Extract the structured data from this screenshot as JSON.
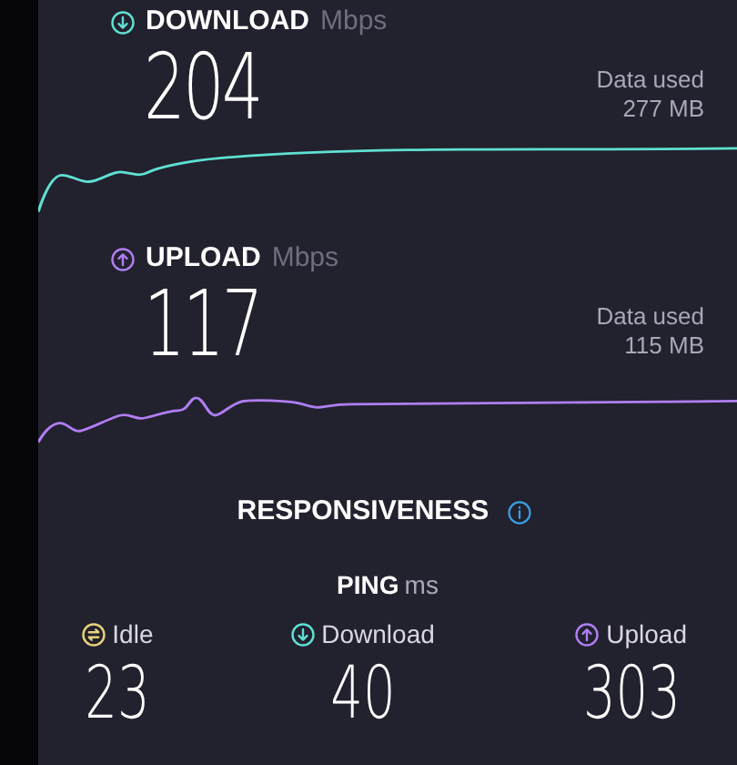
{
  "speeds": [
    {
      "kind": "download",
      "label": "DOWNLOAD",
      "unit": "Mbps",
      "value": "204",
      "data_label": "Data used",
      "data_value": "277 MB"
    },
    {
      "kind": "upload",
      "label": "UPLOAD",
      "unit": "Mbps",
      "value": "117",
      "data_label": "Data used",
      "data_value": "115 MB"
    }
  ],
  "responsiveness": {
    "title": "RESPONSIVENESS"
  },
  "ping": {
    "label": "PING",
    "unit": "ms",
    "items": [
      {
        "kind": "idle",
        "label": "Idle",
        "value": "23"
      },
      {
        "kind": "download",
        "label": "Download",
        "value": "40"
      },
      {
        "kind": "upload",
        "label": "Upload",
        "value": "303"
      }
    ]
  }
}
